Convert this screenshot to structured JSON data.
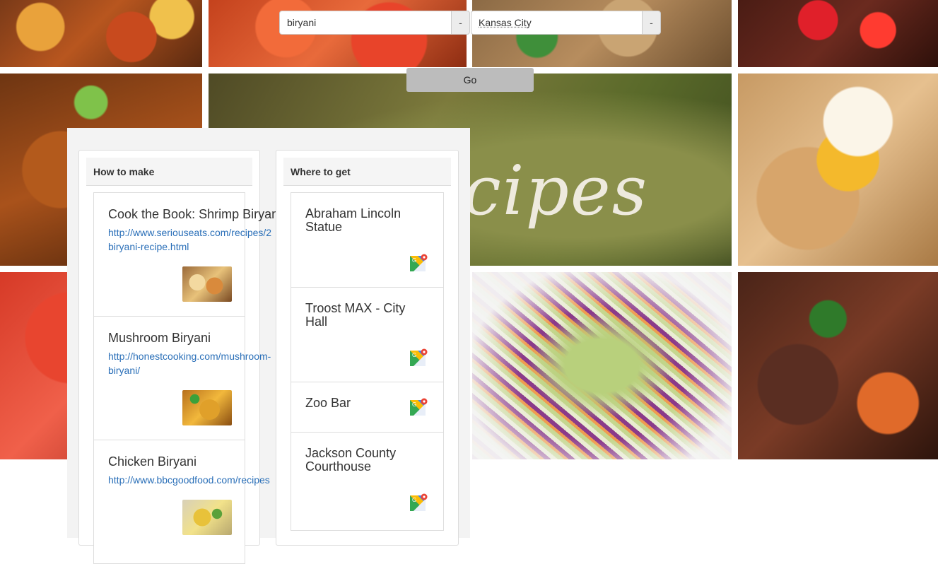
{
  "search": {
    "dish_value": "biryani",
    "dish_clear": "-",
    "city_value": "Kansas City",
    "city_clear": "-",
    "go_label": "Go"
  },
  "background": {
    "banner_text": "cipes"
  },
  "how_to_make": {
    "header": "How to make",
    "items": [
      {
        "title": "Cook the Book: Shrimp Biryani",
        "url": "http://www.seriouseats.com/recipes/2...biryani-recipe.html",
        "url_line1": "http://www.seriouseats.com/recipes/2",
        "url_line2": "biryani-recipe.html"
      },
      {
        "title": "Mushroom Biryani",
        "url_line1": "http://honestcooking.com/mushroom-",
        "url_line2": "biryani/"
      },
      {
        "title": "Chicken Biryani",
        "url_line1": "http://www.bbcgoodfood.com/recipes"
      }
    ]
  },
  "where_to_get": {
    "header": "Where to get",
    "items": [
      {
        "name_line1": "Abraham Lincoln",
        "name_line2": "Statue"
      },
      {
        "name_line1": "Troost MAX - City",
        "name_line2": "Hall"
      },
      {
        "name_line1": "Zoo Bar",
        "name_line2": ""
      },
      {
        "name_line1": "Jackson County",
        "name_line2": "Courthouse"
      }
    ]
  },
  "colors": {
    "link": "#2a6fb8",
    "go_button": "#bcbcbc",
    "panel": "#f3f3f3"
  },
  "icons": {
    "map": "google-maps-icon"
  }
}
